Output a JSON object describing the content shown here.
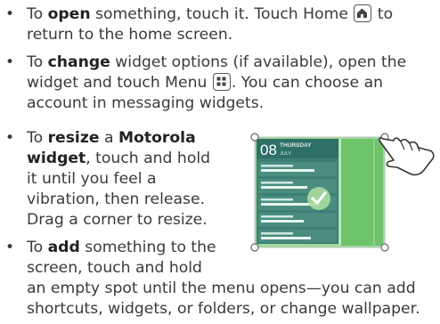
{
  "bullets": [
    {
      "lines": [
        {
          "pre": "To ",
          "bold": "open",
          "post": " something, touch it. Touch Home ",
          "after_icon": " to"
        },
        {
          "text": "return to the home screen."
        }
      ],
      "icon": "home-icon"
    },
    {
      "lines": [
        {
          "pre": "To ",
          "bold": "change",
          "post": " widget options (if available), open the"
        },
        {
          "pre": "widget and touch Menu ",
          "after_icon": ". You can choose an"
        },
        {
          "text": "account in messaging widgets."
        }
      ],
      "icon": "menu-icon"
    },
    {
      "lines": [
        {
          "pre": "To ",
          "bold": "resize",
          "post": " a ",
          "bold2": "Motorola"
        },
        {
          "bold": "widget",
          "post": ", touch and hold"
        },
        {
          "text": "it until you feel a"
        },
        {
          "text": "vibration, then release."
        },
        {
          "text": "Drag a corner to resize."
        }
      ]
    },
    {
      "lines": [
        {
          "pre": "To ",
          "bold": "add",
          "post": " something to the"
        },
        {
          "text": "screen, touch and hold"
        },
        {
          "text": "an empty spot until the menu opens—you can add"
        },
        {
          "text": "shortcuts, widgets, or folders, or change wallpaper."
        }
      ]
    }
  ],
  "widget": {
    "date": "08",
    "day": "THURSDAY",
    "month": "JULY"
  },
  "colors": {
    "text": "#3a3a3a",
    "widget_green": "#5db85a",
    "widget_dark": "#2e6f67"
  }
}
